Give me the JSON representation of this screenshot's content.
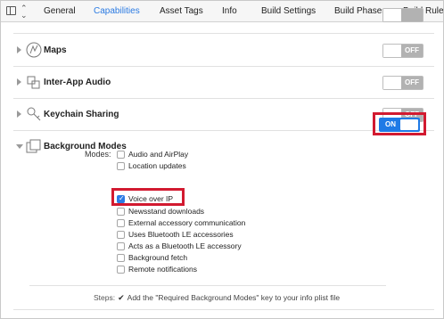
{
  "tabs": [
    {
      "label": "General",
      "active": false
    },
    {
      "label": "Capabilities",
      "active": true
    },
    {
      "label": "Asset Tags",
      "active": false
    },
    {
      "label": "Info",
      "active": false
    },
    {
      "label": "Build Settings",
      "active": false
    },
    {
      "label": "Build Phases",
      "active": false
    },
    {
      "label": "Build Rule",
      "active": false
    }
  ],
  "capabilities": [
    {
      "label": "Maps",
      "icon": "maps-icon",
      "state": "OFF"
    },
    {
      "label": "Inter-App Audio",
      "icon": "inter-app-audio-icon",
      "state": "OFF"
    },
    {
      "label": "Keychain Sharing",
      "icon": "keychain-icon",
      "state": "OFF"
    },
    {
      "label": "Background Modes",
      "icon": "background-modes-icon",
      "state": "ON"
    }
  ],
  "background_modes": {
    "modes_label": "Modes:",
    "items": [
      {
        "label": "Audio and AirPlay",
        "checked": false
      },
      {
        "label": "Location updates",
        "checked": false
      },
      {
        "label": "Voice over IP",
        "checked": true
      },
      {
        "label": "Newsstand downloads",
        "checked": false
      },
      {
        "label": "External accessory communication",
        "checked": false
      },
      {
        "label": "Uses Bluetooth LE accessories",
        "checked": false
      },
      {
        "label": "Acts as a Bluetooth LE accessory",
        "checked": false
      },
      {
        "label": "Background fetch",
        "checked": false
      },
      {
        "label": "Remote notifications",
        "checked": false
      }
    ],
    "steps_label": "Steps:",
    "step_text": "Add the \"Required Background Modes\" key to your info plist file"
  },
  "colors": {
    "accent": "#2a7ae2",
    "highlight": "#d21a30",
    "switch_off": "#b2b2b2"
  }
}
